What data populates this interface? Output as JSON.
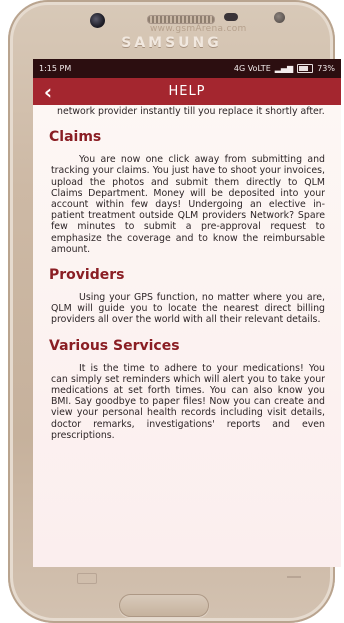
{
  "device": {
    "brand": "SAMSUNG",
    "watermark": "www.gsmArena.com"
  },
  "status_bar": {
    "time": "1:15 PM",
    "indicators": "4G VoLTE",
    "battery": "73%"
  },
  "app_bar": {
    "title": "HELP",
    "back_icon": "back-arrow-icon",
    "color": "#a4262f"
  },
  "content": {
    "intro_text": "network provider instantly till you replace it shortly after.",
    "sections": [
      {
        "heading": "Claims",
        "body": "You are now one click away from submitting and tracking your claims. You just have to shoot your invoices, upload the photos and submit them directly to QLM Claims Department. Money will be deposited into your account within few days! Undergoing an elective in-patient treatment outside QLM providers Network? Spare few minutes to submit a pre-approval request to emphasize the coverage and to know the reimbursable amount."
      },
      {
        "heading": "Providers",
        "body": "Using your GPS function, no matter where you are, QLM will guide you to locate the nearest direct billing providers all over the world with all their relevant details."
      },
      {
        "heading": "Various Services",
        "body": "It is the time to adhere to your medications! You can simply set reminders which will alert you to take your medications at set forth times. You can also know you BMI. Say goodbye to paper files! Now you can create and view your personal health records including visit details, doctor remarks, investigations' reports and even prescriptions."
      }
    ]
  }
}
